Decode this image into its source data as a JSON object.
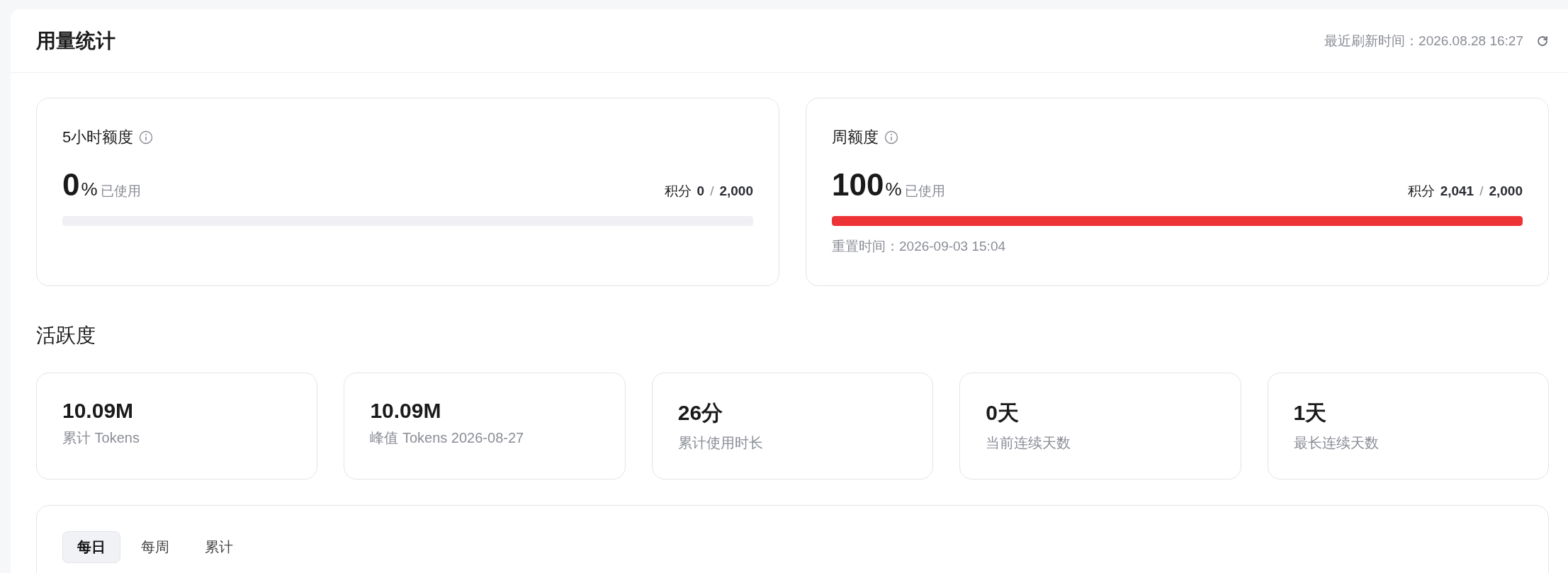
{
  "header": {
    "title": "用量统计",
    "refresh_label": "最近刷新时间：",
    "refresh_time": "2026.08.28 16:27"
  },
  "quotas": [
    {
      "title": "5小时额度",
      "percent": "0",
      "percent_sign": "%",
      "used_label": "已使用",
      "points_label": "积分",
      "points_used": "0",
      "points_separator": "/",
      "points_total": "2,000",
      "level": 0
    },
    {
      "title": "周额度",
      "percent": "100",
      "percent_sign": "%",
      "used_label": "已使用",
      "points_label": "积分",
      "points_used": "2,041",
      "points_separator": "/",
      "points_total": "2,000",
      "level": 1,
      "reset": "重置时间：2026-09-03 15:04"
    }
  ],
  "activity": {
    "title": "活跃度",
    "stats": [
      {
        "value": "10.09M",
        "label": "累计 Tokens"
      },
      {
        "value": "10.09M",
        "label": "峰值 Tokens 2026-08-27"
      },
      {
        "value": "26分",
        "label": "累计使用时长"
      },
      {
        "value": "0天",
        "label": "当前连续天数"
      },
      {
        "value": "1天",
        "label": "最长连续天数"
      }
    ]
  },
  "tabs": [
    {
      "label": "每日",
      "selected": true
    },
    {
      "label": "每周",
      "selected": false
    },
    {
      "label": "累计",
      "selected": false
    }
  ]
}
